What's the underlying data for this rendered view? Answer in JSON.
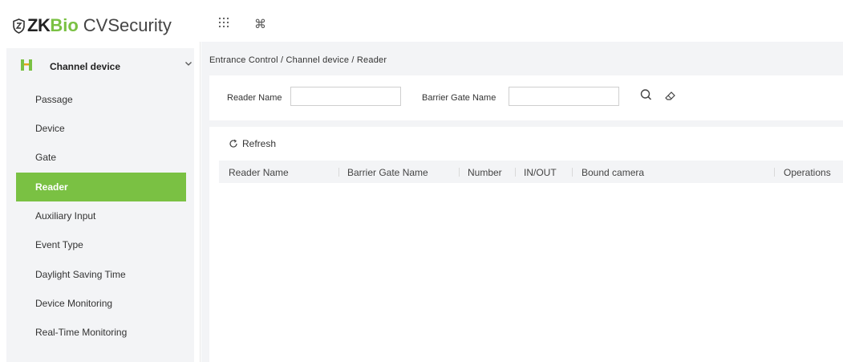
{
  "app": {
    "logo_zk": "ZK",
    "logo_bio": "Bio",
    "logo_cv": "CVSecurity",
    "brand_color": "#7ac143",
    "top_icons": [
      "apps-grid-icon",
      "command-icon"
    ]
  },
  "sidebar": {
    "section_label": "Channel device",
    "section_icon": "turnstile-icon",
    "items": [
      {
        "label": "Passage"
      },
      {
        "label": "Device"
      },
      {
        "label": "Gate"
      },
      {
        "label": "Reader",
        "active": true
      },
      {
        "label": "Auxiliary Input"
      },
      {
        "label": "Event Type"
      },
      {
        "label": "Daylight Saving Time"
      },
      {
        "label": "Device Monitoring"
      },
      {
        "label": "Real-Time Monitoring"
      }
    ]
  },
  "breadcrumb": "Entrance Control / Channel device / Reader",
  "search": {
    "reader_name_label": "Reader Name",
    "reader_name_value": "",
    "barrier_gate_label": "Barrier Gate Name",
    "barrier_gate_value": ""
  },
  "toolbar": {
    "refresh_label": "Refresh"
  },
  "table": {
    "columns": [
      "Reader Name",
      "Barrier Gate Name",
      "Number",
      "IN/OUT",
      "Bound camera",
      "Operations"
    ],
    "rows": []
  }
}
